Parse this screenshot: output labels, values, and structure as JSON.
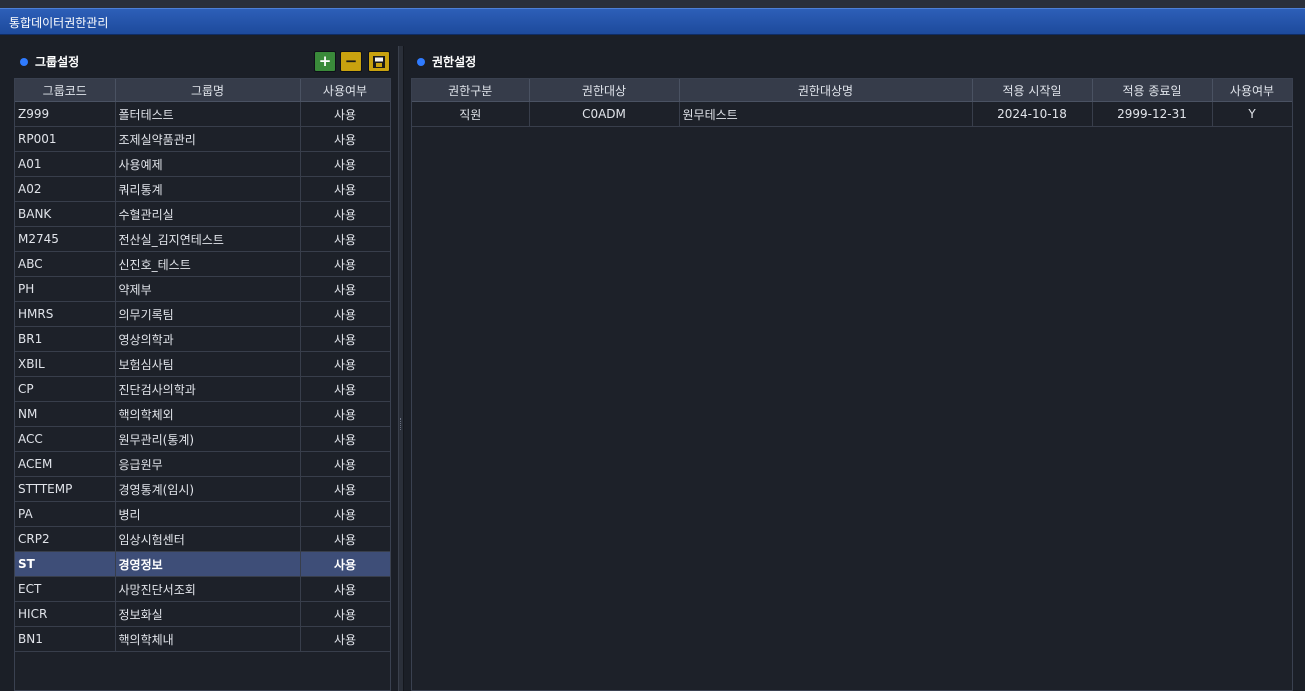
{
  "window": {
    "title": "통합데이터권한관리"
  },
  "group_panel": {
    "title": "그룹설정",
    "buttons": {
      "add": "+",
      "remove": "−"
    },
    "columns": [
      "그룹코드",
      "그룹명",
      "사용여부"
    ],
    "rows": [
      {
        "code": "Z999",
        "name": "폴터테스트",
        "use": "사용"
      },
      {
        "code": "RP001",
        "name": "조제실약품관리",
        "use": "사용"
      },
      {
        "code": " A01",
        "name": "사용예제",
        "use": "사용"
      },
      {
        "code": "A02",
        "name": "쿼리통계",
        "use": "사용"
      },
      {
        "code": "BANK",
        "name": "수혈관리실",
        "use": "사용"
      },
      {
        "code": "M2745",
        "name": "전산실_김지연테스트",
        "use": "사용"
      },
      {
        "code": "ABC",
        "name": "신진호_테스트",
        "use": "사용"
      },
      {
        "code": "PH",
        "name": "약제부",
        "use": "사용"
      },
      {
        "code": "HMRS",
        "name": "의무기록팀",
        "use": "사용"
      },
      {
        "code": "BR1",
        "name": "영상의학과",
        "use": "사용"
      },
      {
        "code": "XBIL",
        "name": "보험심사팀",
        "use": "사용"
      },
      {
        "code": "CP",
        "name": "진단검사의학과",
        "use": "사용"
      },
      {
        "code": "NM",
        "name": "핵의학체외",
        "use": "사용"
      },
      {
        "code": "ACC",
        "name": "원무관리(통계)",
        "use": "사용"
      },
      {
        "code": "ACEM",
        "name": "응급원무",
        "use": "사용"
      },
      {
        "code": "STTTEMP",
        "name": "경영통계(임시)",
        "use": "사용"
      },
      {
        "code": "PA",
        "name": "병리",
        "use": "사용"
      },
      {
        "code": "CRP2",
        "name": "임상시험센터",
        "use": "사용"
      },
      {
        "code": "ST",
        "name": "경영정보",
        "use": "사용"
      },
      {
        "code": "ECT",
        "name": "사망진단서조회",
        "use": "사용"
      },
      {
        "code": "HICR",
        "name": "정보화실",
        "use": "사용"
      },
      {
        "code": "BN1",
        "name": "핵의학체내",
        "use": "사용"
      }
    ],
    "selected_index": 18
  },
  "auth_panel": {
    "title": "권한설정",
    "columns": [
      "권한구분",
      "권한대상",
      "권한대상명",
      "적용 시작일",
      "적용 종료일",
      "사용여부"
    ],
    "rows": [
      {
        "type": "직원",
        "target": "C0ADM",
        "target_name": "원무테스트",
        "start": "2024-10-18",
        "end": "2999-12-31",
        "use": "Y"
      }
    ]
  },
  "icons": {
    "add": "plus-icon",
    "remove": "minus-icon",
    "save": "floppy-disk-icon",
    "section_marker": "blue-dot-icon"
  },
  "colors": {
    "accent": "#2f7bff",
    "titlebar": "#2d5fb8",
    "selected_row": "#3e4e78"
  }
}
